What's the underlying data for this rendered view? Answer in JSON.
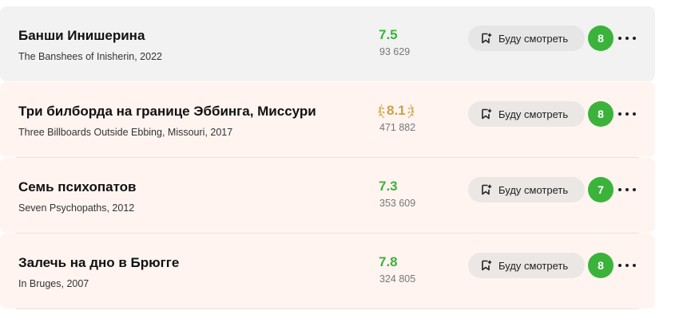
{
  "movies": [
    {
      "title": "Банши Инишерина",
      "original": "The Banshees of Inisherin, 2022",
      "rating": "7.5",
      "votes": "93 629",
      "watch_label": "Буду смотреть",
      "user_score": "8",
      "rating_style": "green",
      "row_bg": "grey"
    },
    {
      "title": "Три билборда на границе Эббинга, Миссури",
      "original": "Three Billboards Outside Ebbing, Missouri, 2017",
      "rating": "8.1",
      "votes": "471 882",
      "watch_label": "Буду смотреть",
      "user_score": "8",
      "rating_style": "gold-laurel",
      "row_bg": "pink"
    },
    {
      "title": "Семь психопатов",
      "original": "Seven Psychopaths, 2012",
      "rating": "7.3",
      "votes": "353 609",
      "watch_label": "Буду смотреть",
      "user_score": "7",
      "rating_style": "green",
      "row_bg": "pink"
    },
    {
      "title": "Залечь на дно в Брюгге",
      "original": "In Bruges, 2007",
      "rating": "7.8",
      "votes": "324 805",
      "watch_label": "Буду смотреть",
      "user_score": "8",
      "rating_style": "green",
      "row_bg": "pink"
    }
  ],
  "colors": {
    "rating_green": "#3bb33b",
    "rating_gold": "#c9a24a",
    "row_grey": "#f2f2f2",
    "row_pink": "#fff4f0"
  },
  "icons": {
    "watch": "bookmark-plus-icon",
    "more": "more-dots-icon",
    "laurel": "laurel-icon"
  }
}
